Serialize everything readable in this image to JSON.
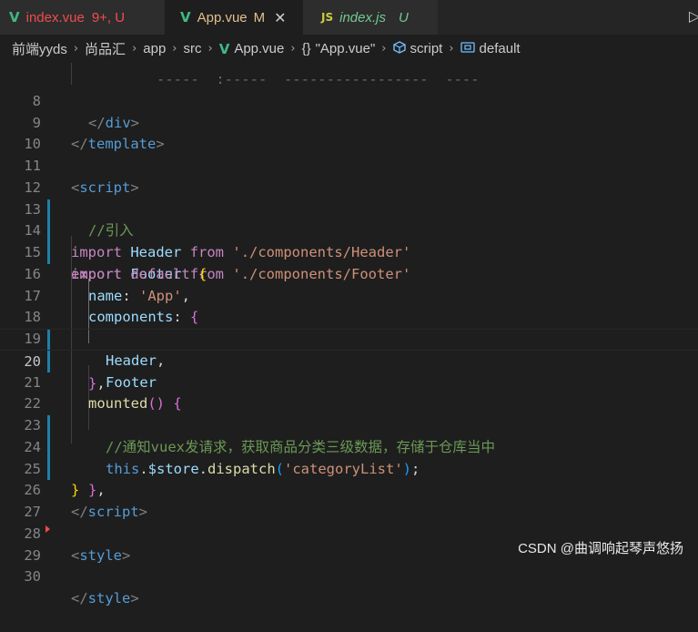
{
  "tabs": [
    {
      "label": "index.vue",
      "status": "9+, U",
      "type": "vue"
    },
    {
      "label": "App.vue",
      "status": "M",
      "type": "vue"
    },
    {
      "label": "index.js",
      "status": "U",
      "type": "js"
    }
  ],
  "tab_icons": {
    "vue": "V",
    "js": "JS",
    "close": "✕",
    "split": "▷"
  },
  "breadcrumb": [
    "前端yyds",
    "尚品汇",
    "app",
    "src",
    "App.vue",
    "\"App.vue\"",
    "script",
    "default"
  ],
  "breadcrumb_icons": {
    "braces": "{}",
    "sep": "›"
  },
  "line_numbers": [
    "8",
    "9",
    "10",
    "11",
    "12",
    "13",
    "14",
    "15",
    "16",
    "17",
    "18",
    "19",
    "20",
    "21",
    "22",
    "23",
    "24",
    "25",
    "26",
    "27",
    "28",
    "29",
    "30"
  ],
  "code": {
    "l7_partial": "      -----  :-----  -----------------  ----",
    "l8_close_div": "div",
    "l9_template": "template",
    "l11_script": "script",
    "l12_comment": "//引入",
    "import_kw": "import",
    "from_kw": "from",
    "header_name": "Header",
    "header_path": "'./components/Header'",
    "footer_name": "Footer",
    "footer_path": "'./components/Footer'",
    "export_kw": "export",
    "default_kw": "default",
    "name_key": "name",
    "name_val": "'App'",
    "components_key": "components",
    "mounted_fn": "mounted",
    "comment_22": "//通知vuex发请求，获取商品分类三级数据，存储于仓库当中",
    "this_kw": "this",
    "store_prop": "$store",
    "dispatch_fn": "dispatch",
    "dispatch_arg": "'categoryList'",
    "style_tag": "style"
  },
  "watermark": "CSDN @曲调响起琴声悠扬",
  "colors": {
    "vue_green": "#41b883",
    "js_yellow": "#cbcb41",
    "modified": "#e2c08d",
    "untracked": "#73c991",
    "error": "#f14c4c"
  }
}
